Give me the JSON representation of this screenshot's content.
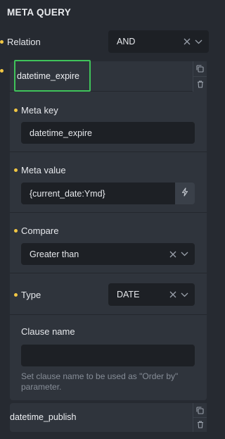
{
  "panel": {
    "title": "META QUERY",
    "relation": {
      "label": "Relation",
      "value": "AND"
    },
    "items": [
      {
        "title": "datetime_expire",
        "meta_key": {
          "label": "Meta key",
          "value": "datetime_expire"
        },
        "meta_value": {
          "label": "Meta value",
          "value": "{current_date:Ymd}"
        },
        "compare": {
          "label": "Compare",
          "value": "Greater than"
        },
        "type": {
          "label": "Type",
          "value": "DATE"
        },
        "clause_name": {
          "label": "Clause name",
          "value": "",
          "help": "Set clause name to be used as \"Order by\" parameter."
        }
      },
      {
        "title": "datetime_publish"
      }
    ]
  },
  "colors": {
    "background": "#262a31",
    "card": "#2f343c",
    "input": "#1d2025",
    "accent_dot": "#f2c744",
    "highlight": "#3fc35a"
  },
  "icons": [
    "clear-icon",
    "chevron-down-icon",
    "clone-icon",
    "trash-icon",
    "lightning-icon"
  ]
}
